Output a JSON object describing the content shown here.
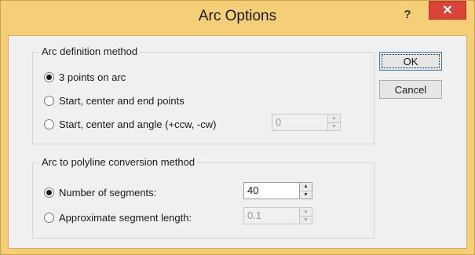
{
  "window": {
    "title": "Arc Options",
    "help_label": "?",
    "close_label": "✕"
  },
  "arc_definition": {
    "group_title": "Arc definition method",
    "options": [
      {
        "label": "3 points on arc",
        "checked": true
      },
      {
        "label": "Start, center and end points",
        "checked": false
      },
      {
        "label": "Start, center and angle (+ccw, -cw)",
        "checked": false
      }
    ],
    "angle_value": "0"
  },
  "conversion": {
    "group_title": "Arc to polyline conversion method",
    "options": [
      {
        "label": "Number of segments:",
        "checked": true,
        "value": "40"
      },
      {
        "label": "Approximate segment length:",
        "checked": false,
        "value": "0.1"
      }
    ]
  },
  "buttons": {
    "ok": "OK",
    "cancel": "Cancel"
  },
  "colors": {
    "titlebar": "#f5cf78",
    "close": "#d9443a",
    "dialog_bg": "#f0f0f0"
  }
}
